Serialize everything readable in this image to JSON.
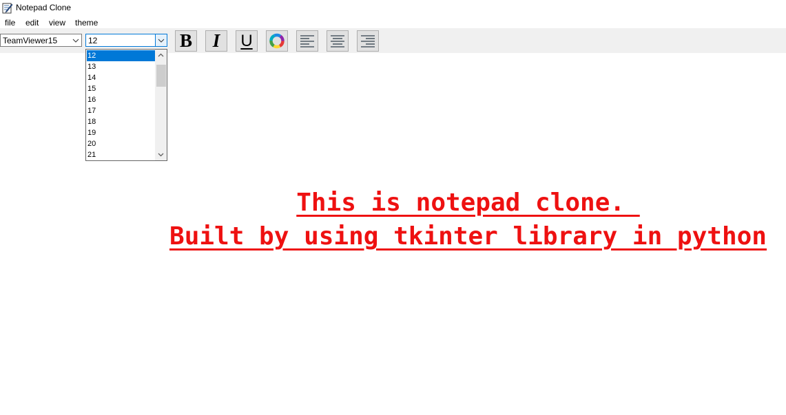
{
  "window": {
    "title": "Notepad Clone"
  },
  "menu": {
    "items": [
      "file",
      "edit",
      "view",
      "theme"
    ]
  },
  "toolbar": {
    "font_family": "TeamViewer15",
    "font_size": "12",
    "bold_label": "B",
    "italic_label": "I",
    "underline_label": "U"
  },
  "font_size_dropdown": {
    "options": [
      "12",
      "13",
      "14",
      "15",
      "16",
      "17",
      "18",
      "19",
      "20",
      "21"
    ],
    "selected": "12"
  },
  "editor": {
    "lines": [
      "This is notepad clone. ",
      "Built by using tkinter library in python"
    ],
    "text_color": "#ee1111"
  },
  "colors": {
    "toolbar_bg": "#f0f0f0",
    "selection": "#0078d7"
  }
}
